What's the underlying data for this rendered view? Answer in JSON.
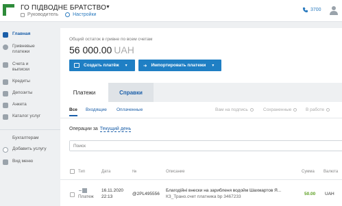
{
  "header": {
    "org_name": "ГО ПІДВОДНЕ БРАТСТВО",
    "role": "Руководитель",
    "settings": "Настройки",
    "phone": "3700"
  },
  "sidebar": {
    "items": [
      {
        "label": "Главная",
        "icon": "home-icon"
      },
      {
        "label": "Гривневые платежи",
        "icon": "hryvnia-icon"
      },
      {
        "label": "Счета и выписки",
        "icon": "accounts-icon"
      },
      {
        "label": "Кредиты",
        "icon": "credit-icon"
      },
      {
        "label": "Депозиты",
        "icon": "deposit-icon"
      },
      {
        "label": "Анкета",
        "icon": "form-icon"
      },
      {
        "label": "Каталог услуг",
        "icon": "catalog-icon"
      }
    ],
    "bottom": [
      {
        "label": "Бухгалтерам"
      },
      {
        "label": "Добавить услугу",
        "icon": "plus-icon"
      },
      {
        "label": "Вид меню",
        "icon": "menu-view-icon"
      }
    ]
  },
  "balance": {
    "label": "Общий остаток в гривне по всем счетам",
    "value": "56 000.00",
    "currency": "UAH"
  },
  "buttons": {
    "create": "Создать платёж",
    "import": "Импортировать платежи"
  },
  "tabs": {
    "payments": "Платежи",
    "references": "Справки"
  },
  "filters": {
    "all": "Все",
    "incoming": "Входящие",
    "paid": "Оплаченные",
    "to_sign": "Вам на подпись",
    "saved": "Сохраненные",
    "in_work": "В работе"
  },
  "operations": {
    "label": "Операции за",
    "period": "Текущий день"
  },
  "search": {
    "placeholder": "Поиск"
  },
  "table": {
    "headers": {
      "type": "Тип",
      "date": "Дата",
      "number": "№",
      "description": "Описание",
      "amount": "Сумма",
      "currency": "Валюта"
    },
    "rows": [
      {
        "type": "Платеж",
        "date": "16.11.2020",
        "time": "22:13",
        "number": "@2PL495556",
        "description": "Благодійні внески на зарибленя водойм Шахмартов Я...",
        "account": "КЗ_Трано.счет платника bp 3467233",
        "amount": "50.00",
        "currency": "UAH"
      }
    ]
  },
  "colors": {
    "accent": "#1f7fc4",
    "link": "#1a5ea8",
    "logo": "#2e8b3a",
    "amount": "#5a9e1e"
  }
}
